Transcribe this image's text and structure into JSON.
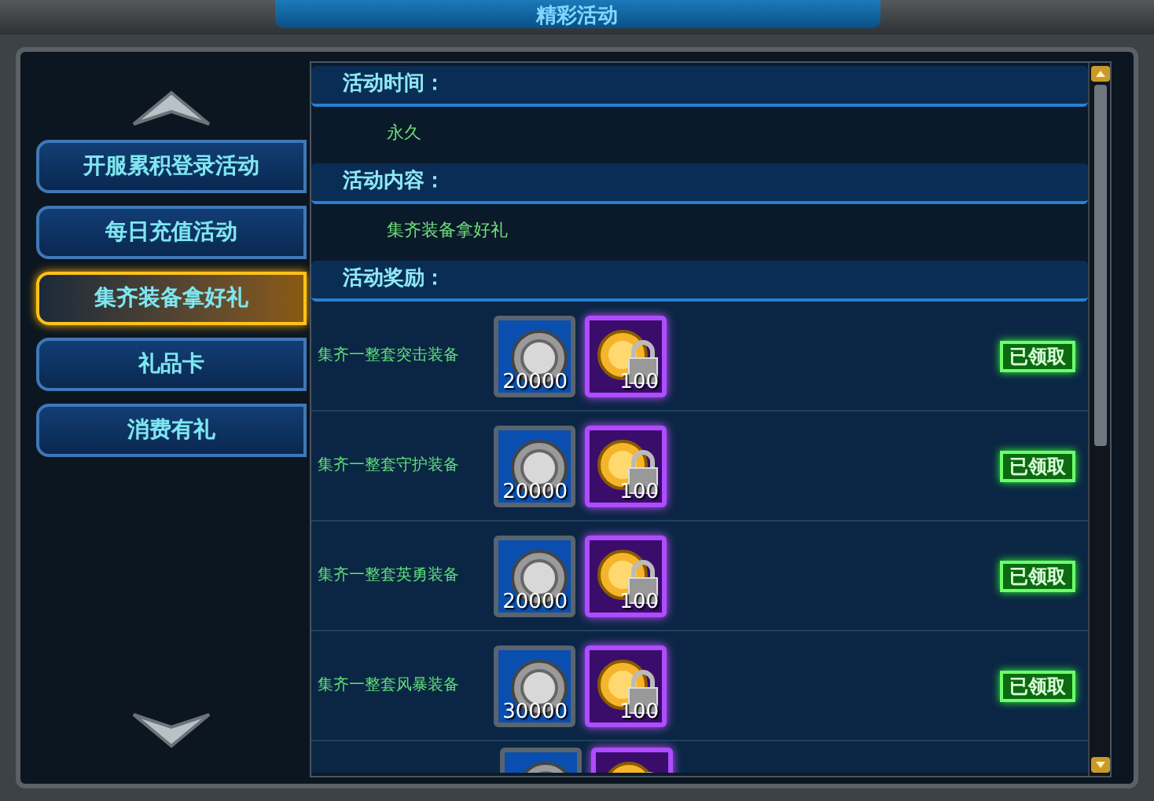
{
  "window": {
    "title": "精彩活动"
  },
  "nav": {
    "items": [
      {
        "label": "开服累积登录活动",
        "selected": false
      },
      {
        "label": "每日充值活动",
        "selected": false
      },
      {
        "label": "集齐装备拿好礼",
        "selected": true
      },
      {
        "label": "礼品卡",
        "selected": false
      },
      {
        "label": "消费有礼",
        "selected": false
      }
    ]
  },
  "sections": [
    {
      "heading": "活动时间：",
      "text": "永久"
    },
    {
      "heading": "活动内容：",
      "text": "集齐装备拿好礼"
    },
    {
      "heading": "活动奖励："
    }
  ],
  "rewards": [
    {
      "label": "集齐一整套突击装备",
      "items": [
        {
          "kind": "silver",
          "amount": "20000"
        },
        {
          "kind": "gold",
          "amount": "100"
        }
      ],
      "button": "已领取"
    },
    {
      "label": "集齐一整套守护装备",
      "items": [
        {
          "kind": "silver",
          "amount": "20000"
        },
        {
          "kind": "gold",
          "amount": "100"
        }
      ],
      "button": "已领取"
    },
    {
      "label": "集齐一整套英勇装备",
      "items": [
        {
          "kind": "silver",
          "amount": "20000"
        },
        {
          "kind": "gold",
          "amount": "100"
        }
      ],
      "button": "已领取"
    },
    {
      "label": "集齐一整套风暴装备",
      "items": [
        {
          "kind": "silver",
          "amount": "30000"
        },
        {
          "kind": "gold",
          "amount": "100"
        }
      ],
      "button": "已领取"
    }
  ],
  "cut_row": {
    "items": [
      {
        "kind": "silver"
      },
      {
        "kind": "gold"
      }
    ]
  }
}
